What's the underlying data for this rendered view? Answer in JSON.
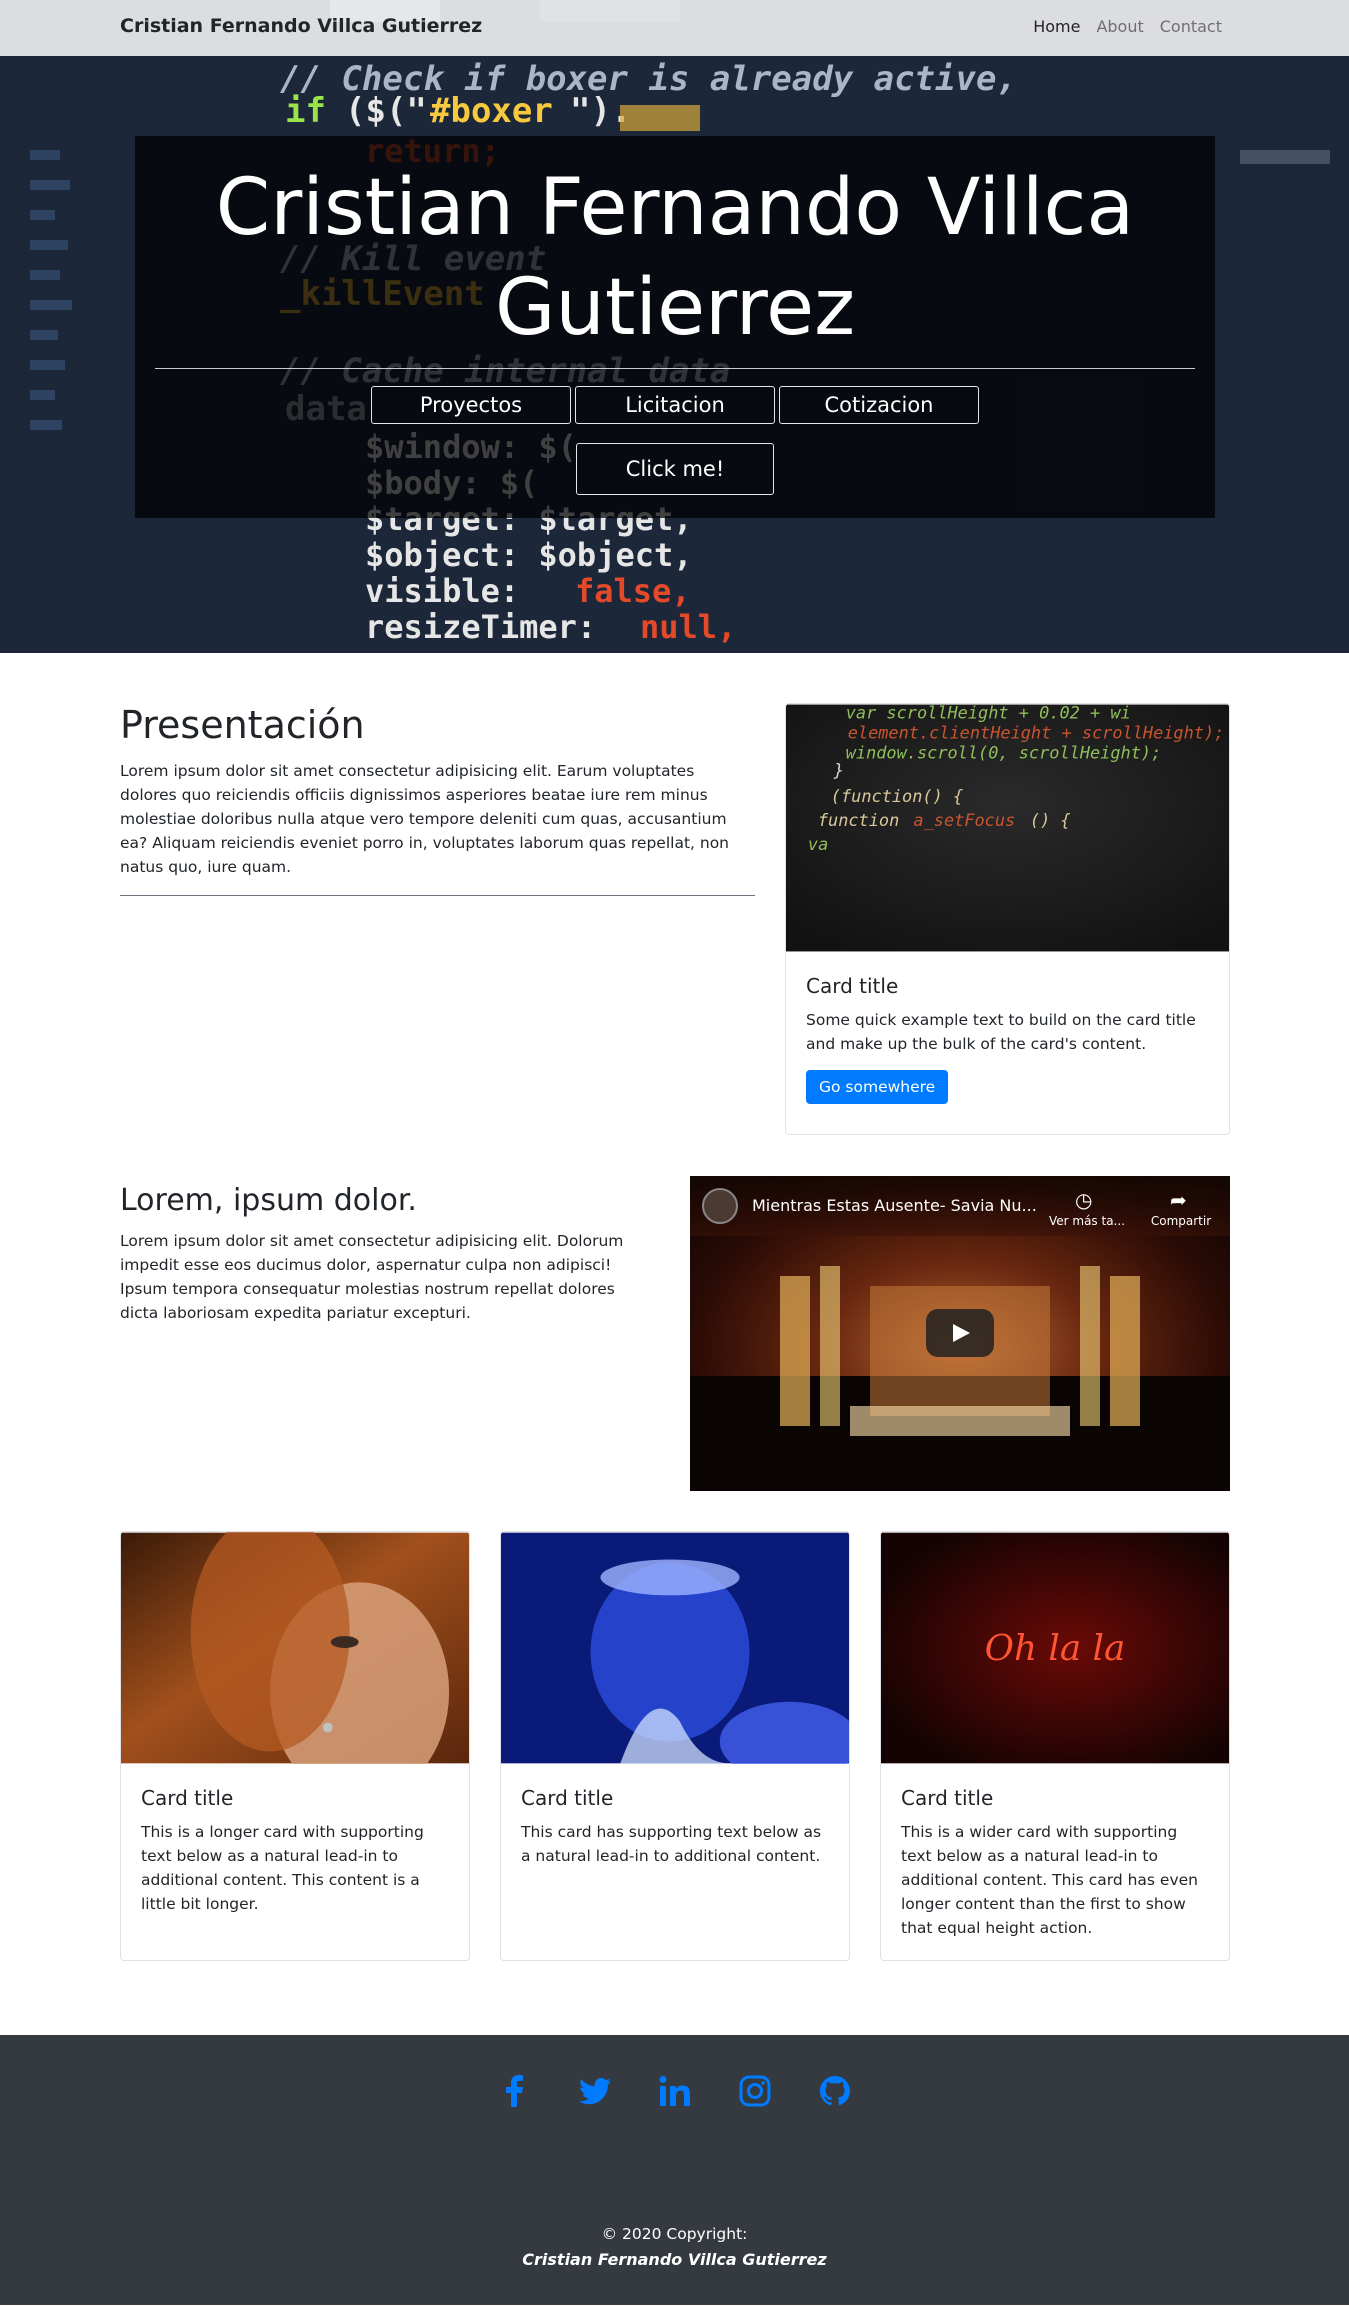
{
  "navbar": {
    "brand": "Cristian Fernando Villca Gutierrez",
    "links": [
      "Home",
      "About",
      "Contact"
    ]
  },
  "hero": {
    "title": "Cristian Fernando Villca Gutierrez",
    "buttons": [
      "Proyectos",
      "Licitacion",
      "Cotizacion"
    ],
    "cta": "Click me!"
  },
  "presentacion": {
    "title": "Presentación",
    "text": "Lorem ipsum dolor sit amet consectetur adipisicing elit. Earum voluptates dolores quo reiciendis officiis dignissimos asperiores beatae iure rem minus molestiae doloribus nulla atque vero tempore deleniti cum quas, accusantium ea? Aliquam reiciendis eveniet porro in, voluptates laborum quas repellat, non natus quo, iure quam."
  },
  "card_main": {
    "title": "Card title",
    "text": "Some quick example text to build on the card title and make up the bulk of the card's content.",
    "button": "Go somewhere"
  },
  "lorem": {
    "title": "Lorem, ipsum dolor.",
    "text": "Lorem ipsum dolor sit amet consectetur adipisicing elit. Dolorum impedit esse eos ducimus dolor, aspernatur culpa non adipisci! Ipsum tempora consequatur molestias nostrum repellat dolores dicta laboriosam expedita pariatur excepturi."
  },
  "video": {
    "title": "Mientras Estas Ausente- Savia Nu...",
    "watch_later": "Ver más ta...",
    "share": "Compartir"
  },
  "cards": [
    {
      "title": "Card title",
      "text": "This is a longer card with supporting text below as a natural lead-in to additional content. This content is a little bit longer."
    },
    {
      "title": "Card title",
      "text": "This card has supporting text below as a natural lead-in to additional content."
    },
    {
      "title": "Card title",
      "text": "This is a wider card with supporting text below as a natural lead-in to additional content. This card has even longer content than the first to show that equal height action.",
      "neon_text": "Oh la la"
    }
  ],
  "footer": {
    "social": [
      "facebook-icon",
      "twitter-icon",
      "linkedin-icon",
      "instagram-icon",
      "github-icon"
    ],
    "social_color": "#007bff",
    "copyright": "© 2020 Copyright:",
    "name": "Cristian Fernando Villca Gutierrez"
  }
}
